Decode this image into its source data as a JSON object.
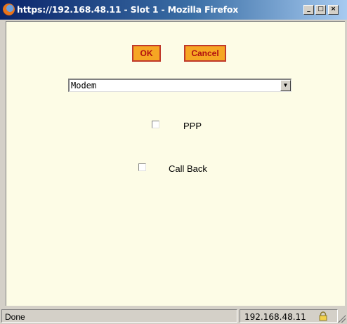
{
  "window": {
    "title": "https://192.168.48.11 - Slot 1 - Mozilla Firefox",
    "controls": {
      "minimize": "_",
      "maximize": "□",
      "close": "×"
    }
  },
  "dialog": {
    "ok_label": "OK",
    "cancel_label": "Cancel",
    "select": {
      "value": "Modem"
    },
    "checkboxes": [
      {
        "label": "PPP",
        "checked": false
      },
      {
        "label": "Call Back",
        "checked": false
      }
    ],
    "button_fill": "#f6a623",
    "button_border": "#c0392b",
    "button_text_color": "#b01010",
    "background": "#fdfce6"
  },
  "statusbar": {
    "status": "Done",
    "host": "192.168.48.11",
    "icon": "lock-icon"
  }
}
